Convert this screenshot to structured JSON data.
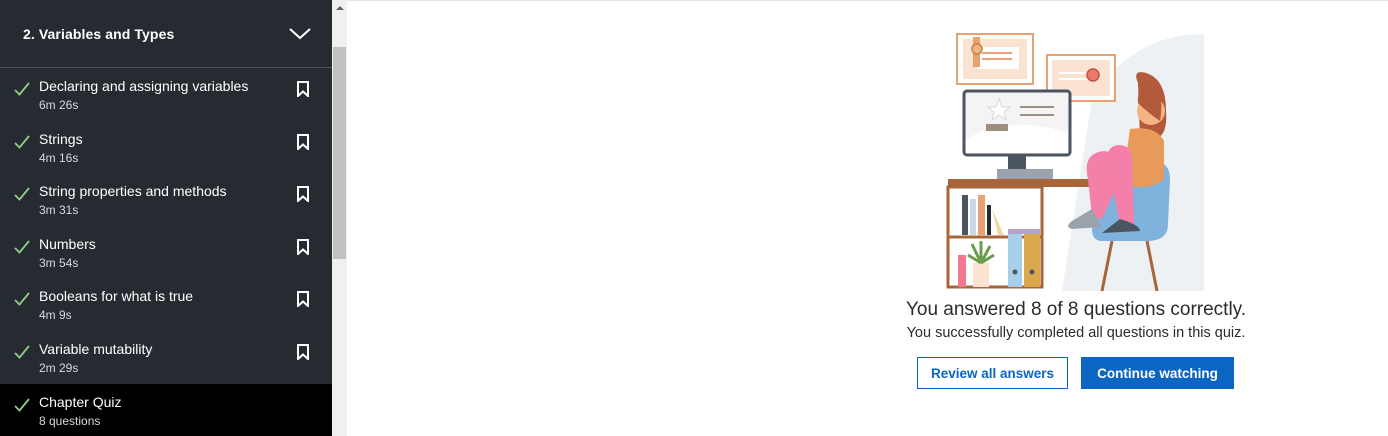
{
  "sidebar": {
    "chapter_title": "2. Variables and Types",
    "items": [
      {
        "title": "Declaring and assigning variables",
        "meta": "6m 26s"
      },
      {
        "title": "Strings",
        "meta": "4m 16s"
      },
      {
        "title": "String properties and methods",
        "meta": "3m 31s"
      },
      {
        "title": "Numbers",
        "meta": "3m 54s"
      },
      {
        "title": "Booleans for what is true",
        "meta": "4m 9s"
      },
      {
        "title": "Variable mutability",
        "meta": "2m 29s"
      },
      {
        "title": "Chapter Quiz",
        "meta": "8 questions"
      }
    ]
  },
  "quiz_result": {
    "title": "You answered 8 of 8 questions correctly.",
    "subtitle": "You successfully completed all questions in this quiz.",
    "review_label": "Review all answers",
    "continue_label": "Continue watching"
  },
  "colors": {
    "sidebar_bg": "#262b31",
    "active_bg": "#000000",
    "check": "#8fcd8a",
    "accent": "#0a66c2"
  }
}
